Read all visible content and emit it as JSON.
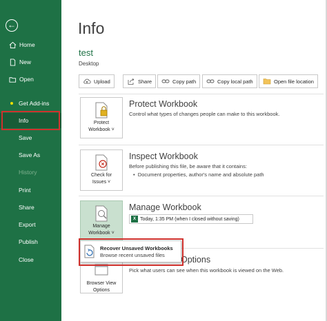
{
  "sidebar": {
    "items": [
      {
        "label": "Home",
        "icon": "home-icon"
      },
      {
        "label": "New",
        "icon": "new-document-icon"
      },
      {
        "label": "Open",
        "icon": "folder-open-icon"
      },
      {
        "label": "Get Add-ins",
        "icon": "add-ins-dot-icon"
      },
      {
        "label": "Info"
      },
      {
        "label": "Save"
      },
      {
        "label": "Save As"
      },
      {
        "label": "History"
      },
      {
        "label": "Print"
      },
      {
        "label": "Share"
      },
      {
        "label": "Export"
      },
      {
        "label": "Publish"
      },
      {
        "label": "Close"
      }
    ],
    "accent": "#1e7145",
    "highlight_color": "#d0312d"
  },
  "main": {
    "title": "Info",
    "file_name": "test",
    "file_location": "Desktop",
    "toolbar": [
      {
        "label": "Upload",
        "icon": "upload-cloud-icon"
      },
      {
        "label": "Share",
        "icon": "share-icon"
      },
      {
        "label": "Copy path",
        "icon": "link-icon"
      },
      {
        "label": "Copy local path",
        "icon": "link-icon"
      },
      {
        "label": "Open file location",
        "icon": "folder-icon"
      }
    ],
    "protect": {
      "button_label_1": "Protect",
      "button_label_2": "Workbook ˅",
      "title": "Protect Workbook",
      "desc": "Control what types of changes people can make to this workbook."
    },
    "inspect": {
      "button_label_1": "Check for",
      "button_label_2": "Issues ˅",
      "title": "Inspect Workbook",
      "desc": "Before publishing this file, be aware that it contains:",
      "bullet": "Document properties, author's name and absolute path"
    },
    "manage": {
      "button_label_1": "Manage",
      "button_label_2": "Workbook ˅",
      "title": "Manage Workbook",
      "version": "Today, 1:35 PM (when I closed without saving)"
    },
    "browser": {
      "button_label_1": "Browser View",
      "button_label_2": "Options",
      "title_fragment": "Options",
      "desc": "Pick what users can see when this workbook is viewed on the Web."
    },
    "dropdown": {
      "title": "Recover Unsaved Workbooks",
      "subtitle": "Browse recent unsaved files"
    }
  }
}
